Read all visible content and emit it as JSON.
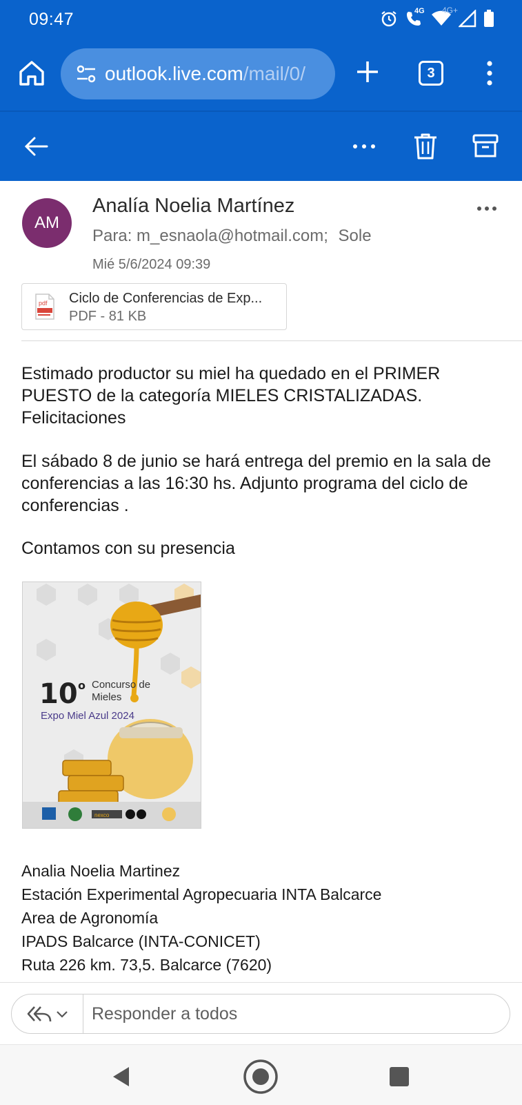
{
  "status_bar": {
    "time": "09:47",
    "network_label_1": "4G",
    "network_label_2": "4G+"
  },
  "browser": {
    "url_host": "outlook.live.com",
    "url_path": "/mail/0/",
    "tab_count": "3"
  },
  "colors": {
    "brand_blue": "#0a63cc",
    "avatar_purple": "#7b2d6e"
  },
  "icons": {
    "home": "home-icon",
    "site_settings": "tune-icon",
    "new_tab": "plus-icon",
    "browser_menu": "more-vertical-icon",
    "back": "arrow-left-icon",
    "more": "more-horizontal-icon",
    "delete": "trash-icon",
    "archive": "archive-icon",
    "attachment": "pdf-file-icon",
    "reply_all": "reply-all-icon",
    "dropdown": "chevron-down-icon"
  },
  "email": {
    "avatar_initials": "AM",
    "sender": "Analía Noelia Martínez",
    "to_prefix": "Para:",
    "to_1": "m_esnaola@hotmail.com;",
    "to_2": "Sole",
    "date": "Mié 5/6/2024 09:39",
    "attachment": {
      "name": "Ciclo de Conferencias de Exp...",
      "meta": "PDF - 81 KB"
    },
    "body": {
      "p1": "Estimado productor su miel ha quedado en el PRIMER PUESTO de la categoría MIELES CRISTALIZADAS. Felicitaciones",
      "p2": "El sábado 8 de junio se hará entrega del premio en la sala de conferencias a las 16:30 hs. Adjunto programa del ciclo de conferencias .",
      "p3": "Contamos con su presencia"
    },
    "poster": {
      "number": "10",
      "ordinal": "o",
      "line1": "Concurso de",
      "line2": "Mieles",
      "line3": "Expo Miel Azul 2024",
      "logo_1": "INTA",
      "logo_2": "nexco",
      "logo_3": "PRO API"
    },
    "signature": [
      "Analia Noelia Martinez",
      "Estación Experimental Agropecuaria INTA Balcarce",
      "Area de Agronomía",
      "IPADS Balcarce (INTA-CONICET)",
      "Ruta 226 km. 73,5. Balcarce (7620)"
    ]
  },
  "reply": {
    "placeholder": "Responder a todos"
  }
}
